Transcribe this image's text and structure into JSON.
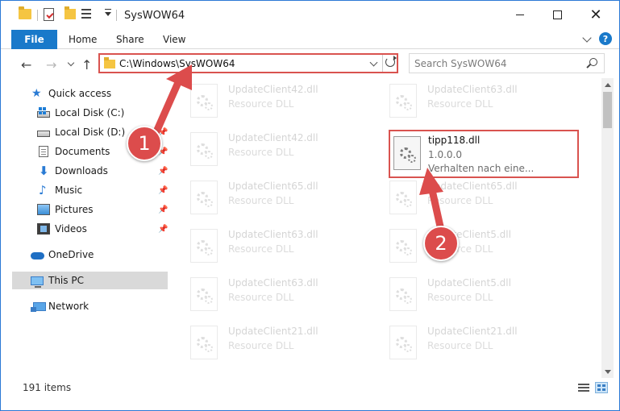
{
  "window": {
    "title": "SysWOW64"
  },
  "ribbon": {
    "file_tab": "File",
    "tabs": [
      {
        "label": "Home"
      },
      {
        "label": "Share"
      },
      {
        "label": "View"
      }
    ],
    "help_label": "?"
  },
  "nav": {
    "back_icon": "←",
    "forward_icon": "→",
    "up_icon": "↑",
    "address_path": "C:\\Windows\\SysWOW64",
    "search_placeholder": "Search SysWOW64"
  },
  "sidebar": {
    "items": [
      {
        "label": "Quick access",
        "icon": "star-icon",
        "pinned": false
      },
      {
        "label": "Local Disk (C:)",
        "icon": "drive-icon",
        "pinned": false
      },
      {
        "label": "Local Disk (D:)",
        "icon": "drive-icon",
        "pinned": true
      },
      {
        "label": "Documents",
        "icon": "documents-icon",
        "pinned": true
      },
      {
        "label": "Downloads",
        "icon": "downloads-icon",
        "pinned": true
      },
      {
        "label": "Music",
        "icon": "music-icon",
        "pinned": true
      },
      {
        "label": "Pictures",
        "icon": "pictures-icon",
        "pinned": true
      },
      {
        "label": "Videos",
        "icon": "videos-icon",
        "pinned": true
      },
      {
        "label": "OneDrive",
        "icon": "onedrive-icon",
        "pinned": false
      },
      {
        "label": "This PC",
        "icon": "this-pc-icon",
        "pinned": false,
        "selected": true
      },
      {
        "label": "Network",
        "icon": "network-icon",
        "pinned": false
      }
    ],
    "pin_glyph": "📌"
  },
  "files": {
    "left": [
      {
        "name": "UpdateClient42.dll",
        "type": "Resource DLL"
      },
      {
        "name": "UpdateClient42.dll",
        "type": "Resource DLL"
      },
      {
        "name": "UpdateClient65.dll",
        "type": "Resource DLL"
      },
      {
        "name": "UpdateClient63.dll",
        "type": "Resource DLL"
      },
      {
        "name": "UpdateClient63.dll",
        "type": "Resource DLL"
      },
      {
        "name": "UpdateClient21.dll",
        "type": "Resource DLL"
      }
    ],
    "right": [
      {
        "name": "UpdateClient63.dll",
        "type": "Resource DLL"
      },
      {
        "name": "UpdateClient65.dll",
        "type": "Resource DLL"
      },
      {
        "name": "UpdateClient5.dll",
        "type": "Resource DLL"
      },
      {
        "name": "UpdateClient5.dll",
        "type": "Resource DLL"
      },
      {
        "name": "UpdateClient21.dll",
        "type": "Resource DLL"
      }
    ],
    "highlighted": {
      "name": "tipp118.dll",
      "version": "1.0.0.0",
      "description": "Verhalten nach eine..."
    }
  },
  "status": {
    "item_count": "191 items"
  },
  "annotations": {
    "step1": "1",
    "step2": "2",
    "color": "#dc4c4c"
  }
}
